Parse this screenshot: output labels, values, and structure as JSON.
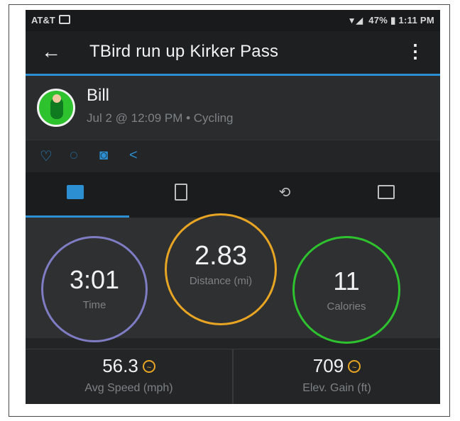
{
  "status_bar": {
    "carrier": "AT&T",
    "battery": "47%",
    "time": "1:11 PM"
  },
  "app_bar": {
    "title": "TBird run up Kirker Pass",
    "back_icon": "arrow-left-icon",
    "menu_icon": "more-vertical-icon"
  },
  "activity": {
    "user_name": "Bill",
    "meta": "Jul 2 @ 12:09 PM • Cycling"
  },
  "social_icons": [
    "heart-icon",
    "comment-icon",
    "camera-icon",
    "share-icon"
  ],
  "tabs": [
    {
      "name": "summary",
      "icon": "chart-icon",
      "active": true
    },
    {
      "name": "details",
      "icon": "document-icon",
      "active": false
    },
    {
      "name": "laps",
      "icon": "loop-icon",
      "active": false
    },
    {
      "name": "stats",
      "icon": "graph-icon",
      "active": false
    }
  ],
  "stats": {
    "time": {
      "value": "3:01",
      "label": "Time"
    },
    "distance": {
      "value": "2.83",
      "label": "Distance (mi)"
    },
    "calories": {
      "value": "11",
      "label": "Calories"
    }
  },
  "metrics": [
    {
      "value": "56.3",
      "label": "Avg Speed (mph)"
    },
    {
      "value": "709",
      "label": "Elev. Gain (ft)"
    }
  ],
  "colors": {
    "accent": "#2c8fd1",
    "time_ring": "#7f7cc4",
    "distance_ring": "#e8a524",
    "calories_ring": "#2ec22e"
  }
}
